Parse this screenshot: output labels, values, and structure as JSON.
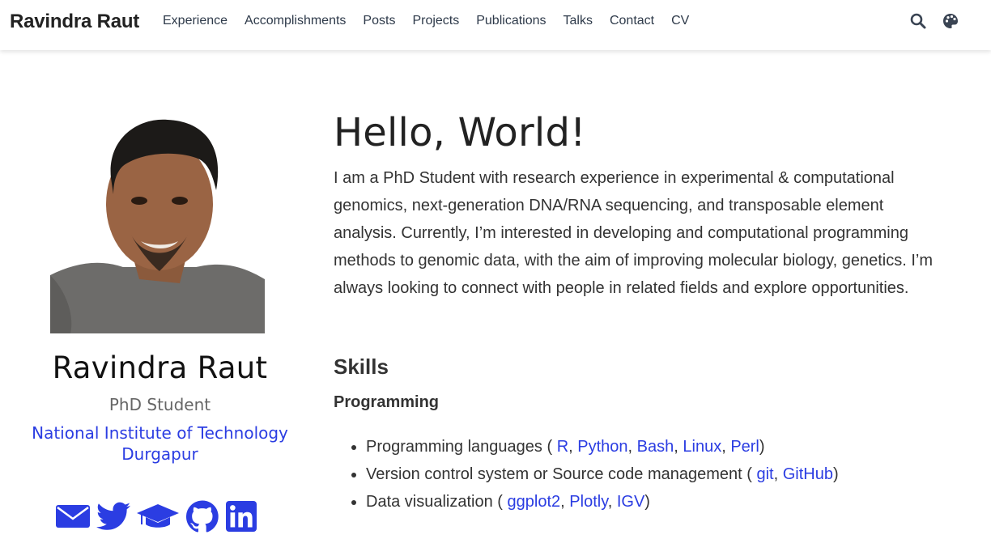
{
  "brand": "Ravindra Raut",
  "nav": [
    "Experience",
    "Accomplishments",
    "Posts",
    "Projects",
    "Publications",
    "Talks",
    "Contact",
    "CV"
  ],
  "profile": {
    "name": "Ravindra Raut",
    "role": "PhD Student",
    "org_line1": "National Institute of Technology",
    "org_line2": "Durgapur"
  },
  "main": {
    "greeting": "Hello, World!",
    "bio": "I am a PhD Student with research experience in experimental & computational genomics, next-generation DNA/RNA sequencing, and transposable element analysis. Currently, I’m interested in developing and computational programming methods to genomic data, with the aim of improving molecular biology, genetics. I’m always looking to connect with people in related fields and explore opportunities.",
    "skills_title": "Skills",
    "programming_title": "Programming",
    "skills": [
      {
        "prefix": "Programming languages ( ",
        "links": [
          "R",
          "Python",
          "Bash",
          "Linux",
          "Perl"
        ],
        "suffix": ")"
      },
      {
        "prefix": "Version control system or Source code management ( ",
        "links": [
          "git",
          "GitHub"
        ],
        "suffix": ")"
      },
      {
        "prefix": "Data visualization ( ",
        "links": [
          "ggplot2",
          "Plotly",
          "IGV"
        ],
        "suffix": ")"
      }
    ]
  },
  "colors": {
    "link": "#2b3de2",
    "icon": "#2b3de2",
    "nav_icon": "#3a4453"
  },
  "icons": [
    "search-icon",
    "palette-icon",
    "email-icon",
    "twitter-icon",
    "graduation-cap-icon",
    "github-icon",
    "linkedin-icon"
  ]
}
